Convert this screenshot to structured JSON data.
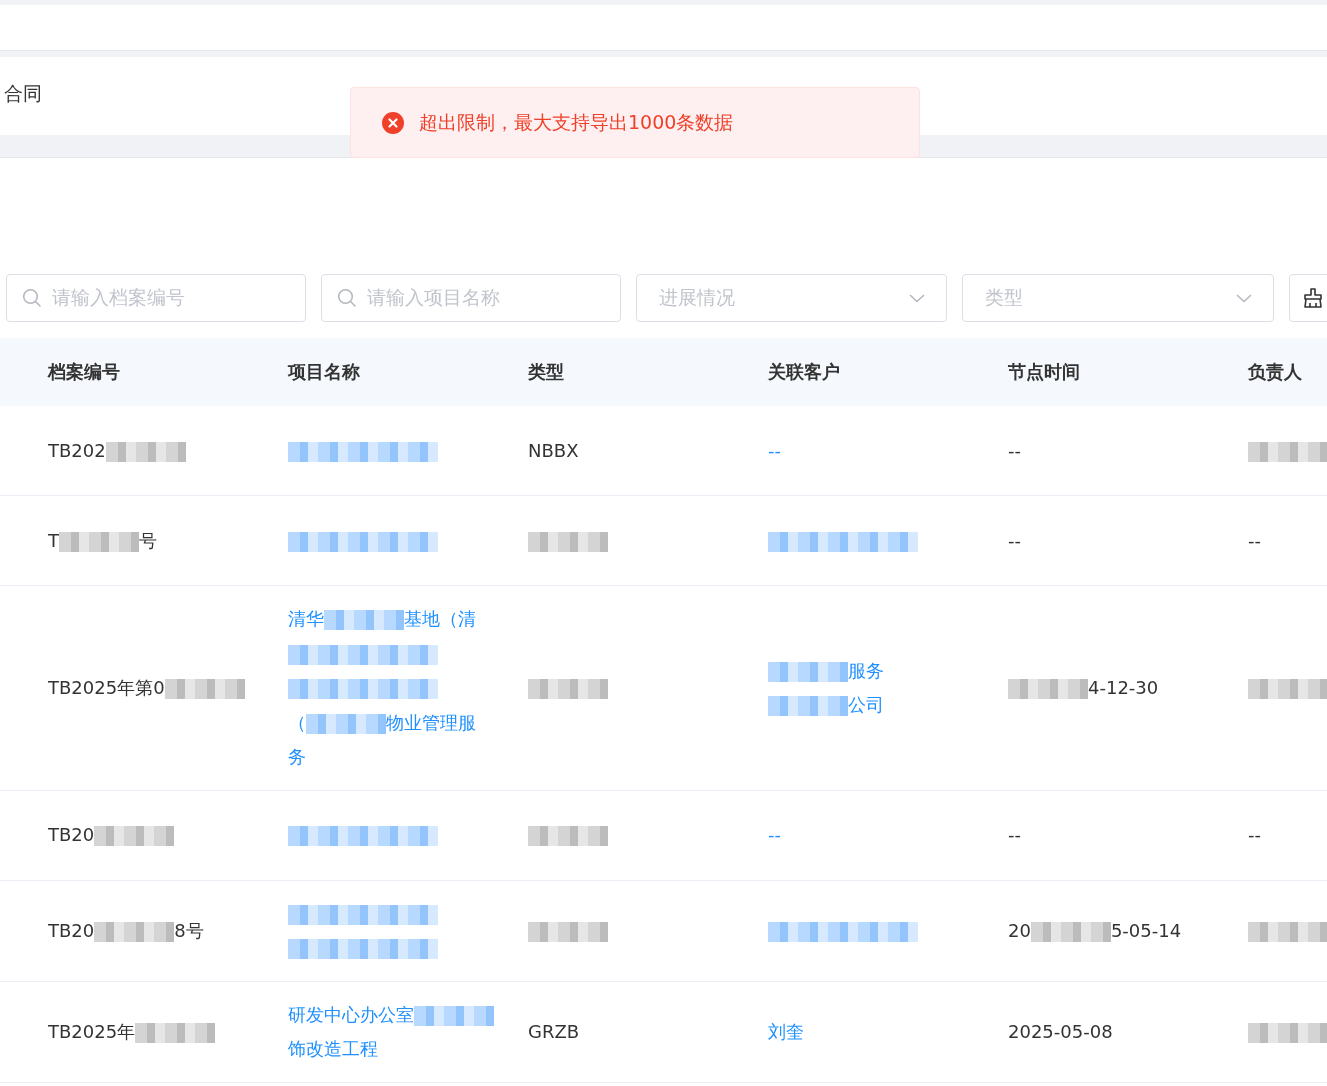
{
  "tab": {
    "label": "合同"
  },
  "toast": {
    "kind": "error",
    "message": "超出限制，最大支持导出1000条数据"
  },
  "filters": [
    {
      "kind": "search",
      "placeholder": "请输入档案编号"
    },
    {
      "kind": "search",
      "placeholder": "请输入项目名称"
    },
    {
      "kind": "select",
      "placeholder": "进展情况"
    },
    {
      "kind": "select",
      "placeholder": "类型"
    },
    {
      "kind": "clear-button"
    }
  ],
  "table": {
    "columns": [
      {
        "label": "档案编号",
        "kind": "text"
      },
      {
        "label": "项目名称",
        "kind": "link"
      },
      {
        "label": "类型",
        "kind": "text"
      },
      {
        "label": "关联客户",
        "kind": "link"
      },
      {
        "label": "节点时间",
        "kind": "text"
      },
      {
        "label": "负责人",
        "kind": "text"
      }
    ],
    "rows": [
      {
        "cells": [
          {
            "lines": [
              [
                {
                  "text": "TB202"
                },
                {
                  "kind": "redacted"
                }
              ]
            ]
          },
          {
            "lines": [
              [
                {
                  "kind": "redacted"
                }
              ]
            ]
          },
          {
            "lines": [
              [
                {
                  "text": "NBBX"
                }
              ]
            ]
          },
          {
            "lines": [
              [
                {
                  "text": "--"
                }
              ]
            ]
          },
          {
            "lines": [
              [
                {
                  "text": "--"
                }
              ]
            ]
          },
          {
            "lines": [
              [
                {
                  "kind": "redacted"
                }
              ]
            ]
          }
        ]
      },
      {
        "cells": [
          {
            "lines": [
              [
                {
                  "text": "T"
                },
                {
                  "kind": "redacted"
                },
                {
                  "text": "号"
                }
              ]
            ]
          },
          {
            "lines": [
              [
                {
                  "kind": "redacted"
                }
              ]
            ]
          },
          {
            "lines": [
              [
                {
                  "kind": "redacted"
                }
              ]
            ]
          },
          {
            "lines": [
              [
                {
                  "kind": "redacted"
                }
              ]
            ]
          },
          {
            "lines": [
              [
                {
                  "text": "--"
                }
              ]
            ]
          },
          {
            "lines": [
              [
                {
                  "text": "--"
                }
              ]
            ]
          }
        ]
      },
      {
        "cells": [
          {
            "lines": [
              [
                {
                  "text": "TB2025年第0"
                },
                {
                  "kind": "redacted"
                }
              ]
            ]
          },
          {
            "lines": [
              [
                {
                  "text": "清华"
                },
                {
                  "kind": "redacted"
                },
                {
                  "text": "基地（清"
                }
              ],
              [
                {
                  "kind": "redacted"
                }
              ],
              [
                {
                  "kind": "redacted"
                }
              ],
              [
                {
                  "text": "（"
                },
                {
                  "kind": "redacted"
                },
                {
                  "text": "物业管理服"
                }
              ],
              [
                {
                  "text": "务"
                }
              ]
            ]
          },
          {
            "lines": [
              [
                {
                  "kind": "redacted"
                }
              ]
            ]
          },
          {
            "lines": [
              [
                {
                  "kind": "redacted"
                },
                {
                  "text": "服务"
                }
              ],
              [
                {
                  "kind": "redacted"
                },
                {
                  "text": "公司"
                }
              ]
            ]
          },
          {
            "lines": [
              [
                {
                  "kind": "redacted"
                },
                {
                  "text": "4-12-30"
                }
              ]
            ]
          },
          {
            "lines": [
              [
                {
                  "kind": "redacted"
                }
              ]
            ]
          }
        ]
      },
      {
        "cells": [
          {
            "lines": [
              [
                {
                  "text": "TB20"
                },
                {
                  "kind": "redacted"
                }
              ]
            ]
          },
          {
            "lines": [
              [
                {
                  "kind": "redacted"
                }
              ]
            ]
          },
          {
            "lines": [
              [
                {
                  "kind": "redacted"
                }
              ]
            ]
          },
          {
            "lines": [
              [
                {
                  "text": "--"
                }
              ]
            ]
          },
          {
            "lines": [
              [
                {
                  "text": "--"
                }
              ]
            ]
          },
          {
            "lines": [
              [
                {
                  "text": "--"
                }
              ]
            ]
          }
        ]
      },
      {
        "cells": [
          {
            "lines": [
              [
                {
                  "text": "TB20"
                },
                {
                  "kind": "redacted"
                },
                {
                  "text": "8号"
                }
              ]
            ]
          },
          {
            "lines": [
              [
                {
                  "kind": "redacted"
                }
              ],
              [
                {
                  "kind": "redacted"
                }
              ]
            ]
          },
          {
            "lines": [
              [
                {
                  "kind": "redacted"
                }
              ]
            ]
          },
          {
            "lines": [
              [
                {
                  "kind": "redacted"
                }
              ]
            ]
          },
          {
            "lines": [
              [
                {
                  "text": "20"
                },
                {
                  "kind": "redacted"
                },
                {
                  "text": "5-05-14"
                }
              ]
            ]
          },
          {
            "lines": [
              [
                {
                  "kind": "redacted"
                }
              ]
            ]
          }
        ]
      },
      {
        "cells": [
          {
            "lines": [
              [
                {
                  "text": "TB2025年"
                },
                {
                  "kind": "redacted"
                }
              ]
            ]
          },
          {
            "lines": [
              [
                {
                  "text": "研发中心办公室"
                },
                {
                  "kind": "redacted"
                }
              ],
              [
                {
                  "text": "饰改造工程"
                }
              ]
            ]
          },
          {
            "lines": [
              [
                {
                  "text": "GRZB"
                }
              ]
            ]
          },
          {
            "lines": [
              [
                {
                  "text": "刘奎"
                }
              ]
            ]
          },
          {
            "lines": [
              [
                {
                  "text": "2025-05-08"
                }
              ]
            ]
          },
          {
            "lines": [
              [
                {
                  "kind": "redacted"
                }
              ]
            ]
          }
        ]
      }
    ]
  }
}
